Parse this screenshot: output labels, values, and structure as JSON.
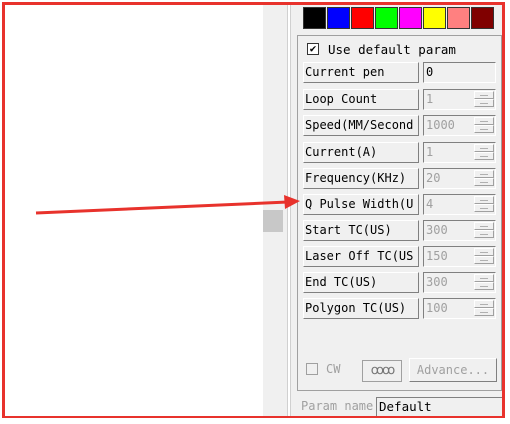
{
  "palette": [
    {
      "name": "black",
      "color": "#000000"
    },
    {
      "name": "blue",
      "color": "#0000ff"
    },
    {
      "name": "red",
      "color": "#ff0000"
    },
    {
      "name": "green",
      "color": "#00ff00"
    },
    {
      "name": "magenta",
      "color": "#ff00ff"
    },
    {
      "name": "yellow",
      "color": "#ffff00"
    },
    {
      "name": "salmon",
      "color": "#ff8080"
    },
    {
      "name": "maroon",
      "color": "#800000"
    }
  ],
  "use_default_param": {
    "checked": true,
    "label": "Use default param"
  },
  "params": [
    {
      "label": "Current pen",
      "value": "0",
      "editable": true
    },
    {
      "label": "Loop Count",
      "value": "1",
      "editable": false
    },
    {
      "label": "Speed(MM/Second",
      "value": "1000",
      "editable": false
    },
    {
      "label": "Current(A)",
      "value": "1",
      "editable": false
    },
    {
      "label": "Frequency(KHz)",
      "value": "20",
      "editable": false
    },
    {
      "label": "Q Pulse Width(U",
      "value": "4",
      "editable": false
    },
    {
      "label": "Start TC(US)",
      "value": "300",
      "editable": false
    },
    {
      "label": "Laser Off TC(US",
      "value": "150",
      "editable": false
    },
    {
      "label": "End TC(US)",
      "value": "300",
      "editable": false
    },
    {
      "label": "Polygon TC(US)",
      "value": "100",
      "editable": false
    }
  ],
  "cw": {
    "label": "CW",
    "checked": false
  },
  "advance_button": {
    "label": "Advance..."
  },
  "param_name": {
    "label": "Param name",
    "value": "Default"
  },
  "annotation": {
    "color": "#e8322c"
  }
}
